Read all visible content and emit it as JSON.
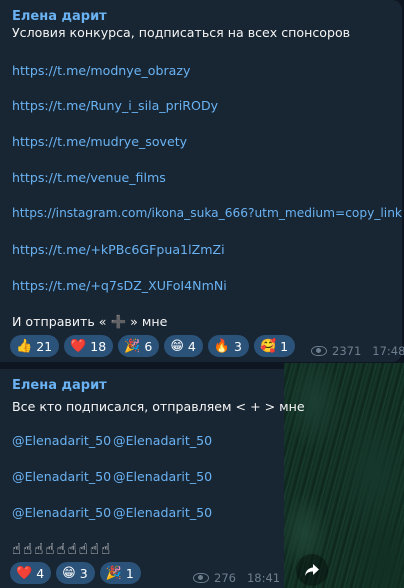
{
  "message1": {
    "sender": "Елена дарит",
    "text_title": "Условия конкурса, подписаться на всех спонсоров",
    "links": [
      "https://t.me/modnye_obrazy",
      "https://t.me/Runy_i_sila_priRODy",
      "https://t.me/mudrye_sovety",
      "https://t.me/venue_films",
      "https://instagram.com/ikona_suka_666?utm_medium=copy_link",
      " https://t.me/+kPBc6GFpua1lZmZi",
      "https://t.me/+q7sDZ_XUFoI4NmNi"
    ],
    "closing_text": "И отправить « ➕ » мне",
    "reactions": [
      {
        "emoji": "👍",
        "count": "21"
      },
      {
        "emoji": "❤️",
        "count": "18"
      },
      {
        "emoji": "🎉",
        "count": "6"
      },
      {
        "emoji": "😁",
        "count": "4"
      },
      {
        "emoji": "🔥",
        "count": "3"
      },
      {
        "emoji": "🥰",
        "count": "1"
      }
    ],
    "views": "2371",
    "time": "17:48"
  },
  "message2": {
    "sender": "Елена дарит",
    "text": "Все кто подписался, отправляем < + > мне",
    "mentions": [
      [
        "@Elenadarit_50",
        "@Elenadarit_50"
      ],
      [
        "@Elenadarit_50",
        "@Elenadarit_50"
      ],
      [
        "@Elenadarit_50",
        "@Elenadarit_50"
      ]
    ],
    "hands": "☝☝☝☝☝☝☝☝☝",
    "reactions": [
      {
        "emoji": "❤️",
        "count": "4"
      },
      {
        "emoji": "😁",
        "count": "3"
      },
      {
        "emoji": "🎉",
        "count": "1"
      }
    ],
    "views": "276",
    "time": "18:41"
  },
  "icons": {
    "views": "eye-icon",
    "share": "share-arrow-icon"
  },
  "colors": {
    "background": "#0e1621",
    "bubble": "#182533",
    "link": "#6ab3f3",
    "reaction_bg": "#2b5278"
  }
}
